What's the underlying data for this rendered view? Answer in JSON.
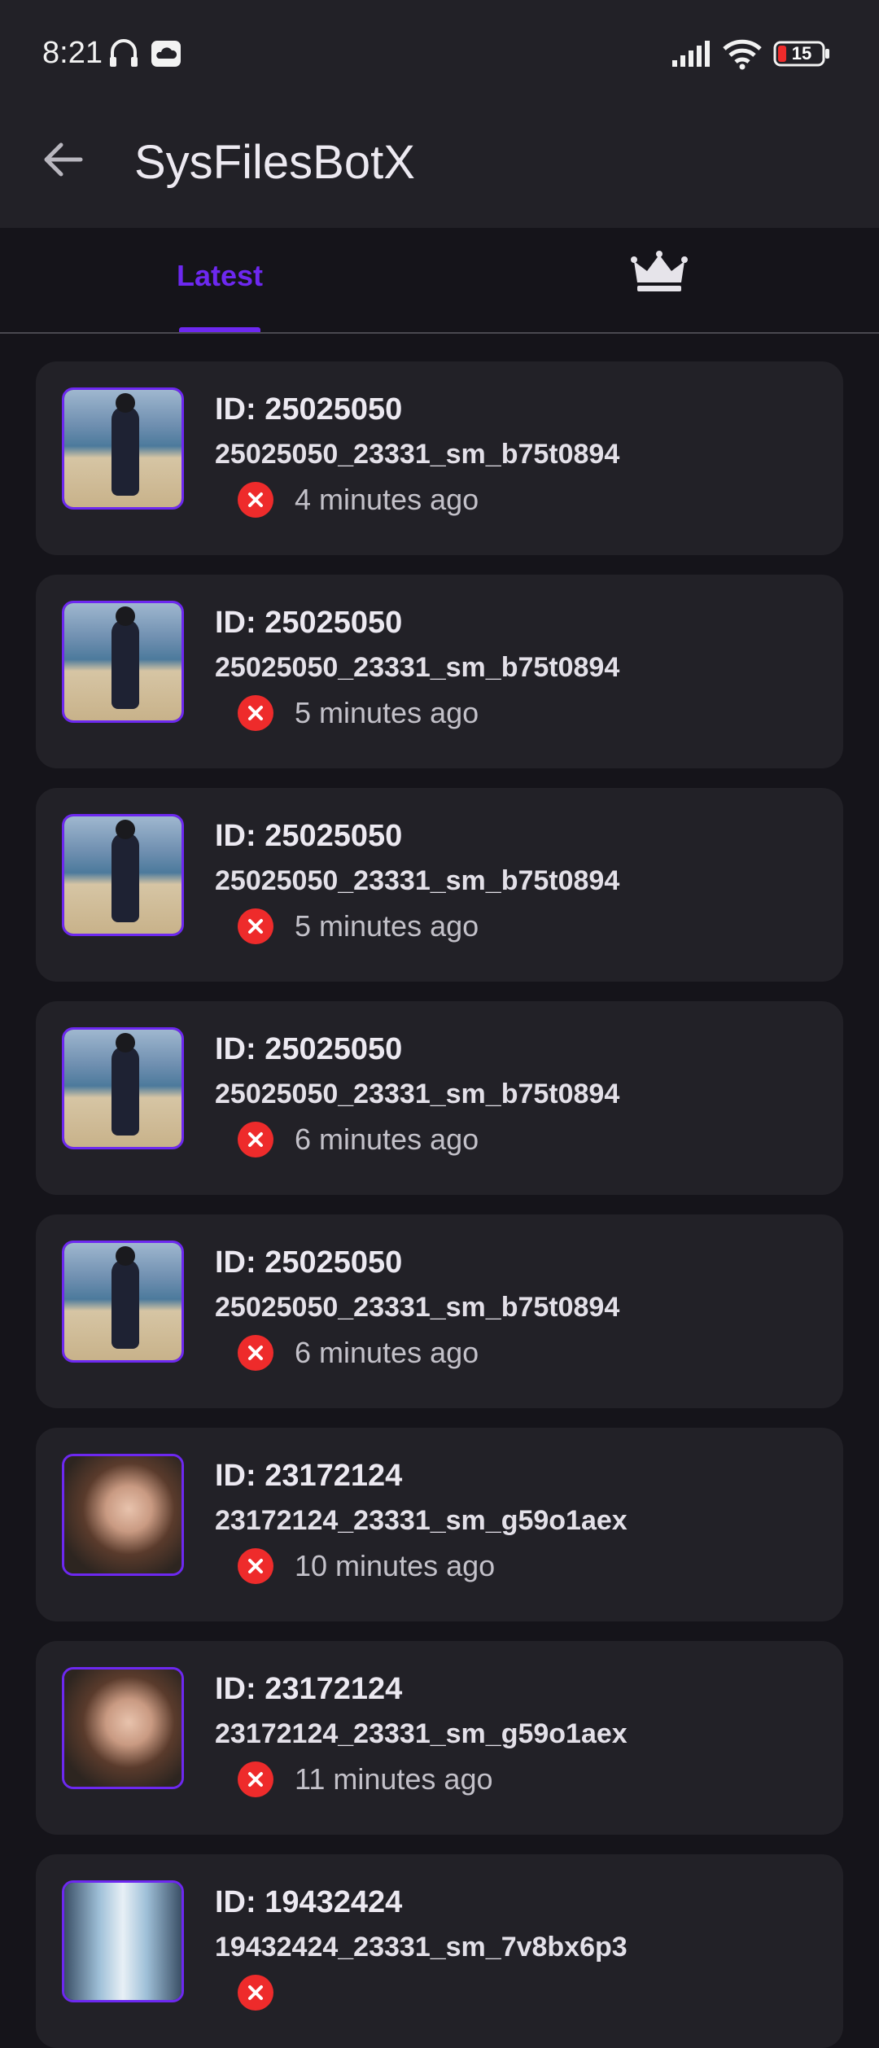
{
  "status_bar": {
    "time": "8:21",
    "battery": "15",
    "icons": [
      "headphone-icon",
      "cloud-icon",
      "signal-icon",
      "wifi-icon",
      "battery-icon"
    ]
  },
  "app_bar": {
    "title": "SysFilesBotX",
    "back_icon": "arrow-back-icon"
  },
  "tabs": [
    {
      "label": "Latest",
      "selected": true
    },
    {
      "label": "",
      "icon": "crown-icon",
      "selected": false
    }
  ],
  "colors": {
    "accent": "#6d28f0",
    "error": "#ee2b2b",
    "background": "#15141a",
    "card": "#222127"
  },
  "items": [
    {
      "id": "ID: 25025050",
      "file": "25025050_23331_sm_b75t0894",
      "time": "4 minutes ago",
      "thumb": "beach",
      "status": "error-icon"
    },
    {
      "id": "ID: 25025050",
      "file": "25025050_23331_sm_b75t0894",
      "time": "5 minutes ago",
      "thumb": "beach",
      "status": "error-icon"
    },
    {
      "id": "ID: 25025050",
      "file": "25025050_23331_sm_b75t0894",
      "time": "5 minutes ago",
      "thumb": "beach",
      "status": "error-icon"
    },
    {
      "id": "ID: 25025050",
      "file": "25025050_23331_sm_b75t0894",
      "time": "6 minutes ago",
      "thumb": "beach",
      "status": "error-icon"
    },
    {
      "id": "ID: 25025050",
      "file": "25025050_23331_sm_b75t0894",
      "time": "6 minutes ago",
      "thumb": "beach",
      "status": "error-icon"
    },
    {
      "id": "ID: 23172124",
      "file": "23172124_23331_sm_g59o1aex",
      "time": "10 minutes ago",
      "thumb": "portrait",
      "status": "error-icon"
    },
    {
      "id": "ID: 23172124",
      "file": "23172124_23331_sm_g59o1aex",
      "time": "11 minutes ago",
      "thumb": "portrait",
      "status": "error-icon"
    },
    {
      "id": "ID: 19432424",
      "file": "19432424_23331_sm_7v8bx6p3",
      "time": "",
      "thumb": "waterfall",
      "status": "error-icon"
    }
  ]
}
